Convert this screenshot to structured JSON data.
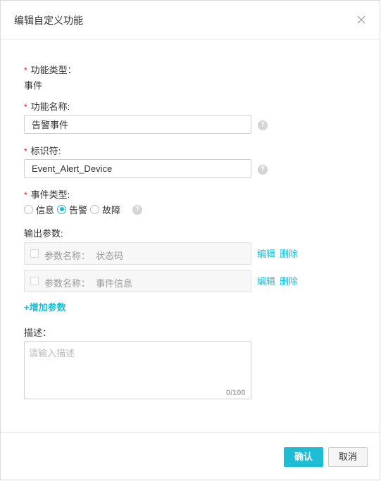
{
  "dialog": {
    "title": "编辑自定义功能",
    "close_icon": "close-icon"
  },
  "form": {
    "function_type": {
      "required": "*",
      "label": "功能类型：",
      "value": "事件"
    },
    "function_name": {
      "required": "*",
      "label": "功能名称:",
      "value": "告警事件"
    },
    "identifier": {
      "required": "*",
      "label": "标识符:",
      "value": "Event_Alert_Device"
    },
    "event_type": {
      "required": "*",
      "label": "事件类型:",
      "options": [
        {
          "label": "信息",
          "checked": false
        },
        {
          "label": "告警",
          "checked": true
        },
        {
          "label": "故障",
          "checked": false
        }
      ],
      "selected": "告警"
    },
    "help_icon": "?",
    "output_params": {
      "label": "输出参数:",
      "param_prefix": "参数名称：",
      "items": [
        {
          "name": "状态码",
          "edit": "编辑",
          "delete": "删除"
        },
        {
          "name": "事件信息",
          "edit": "编辑",
          "delete": "删除"
        }
      ],
      "add_label": "+增加参数"
    },
    "description": {
      "label": "描述：",
      "placeholder": "请输入描述",
      "counter": "0/100"
    }
  },
  "footer": {
    "confirm_label": "确认",
    "cancel_label": "取消"
  },
  "colors": {
    "accent": "#1ebdd6",
    "required": "#e5231a"
  }
}
